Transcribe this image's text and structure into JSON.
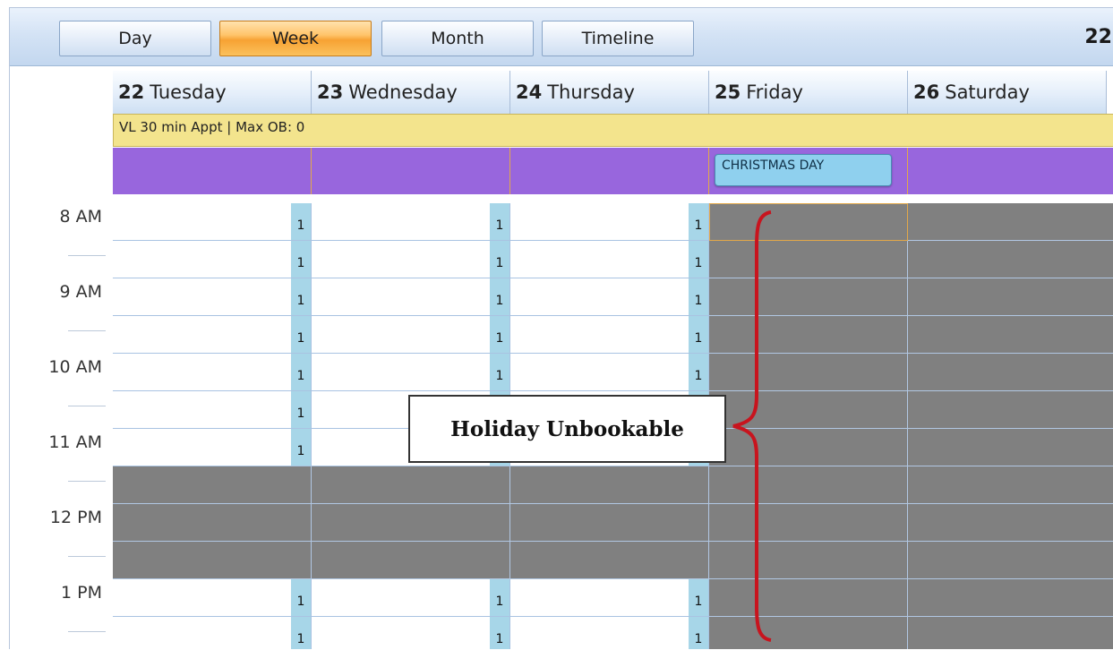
{
  "toolbar": {
    "views": [
      "Day",
      "Week",
      "Month",
      "Timeline"
    ],
    "active_view": "Week",
    "range_text": "22"
  },
  "days": [
    {
      "num": "22",
      "name": "Tuesday"
    },
    {
      "num": "23",
      "name": "Wednesday"
    },
    {
      "num": "24",
      "name": "Thursday"
    },
    {
      "num": "25",
      "name": "Friday"
    },
    {
      "num": "26",
      "name": "Saturday"
    }
  ],
  "all_day_banner": "VL 30 min Appt | Max OB: 0",
  "holiday_event": "CHRISTMAS DAY",
  "time_labels": [
    "8 AM",
    "9 AM",
    "10 AM",
    "11 AM",
    "12 PM",
    "1 PM"
  ],
  "slot_capacity": "1",
  "annotation": "Holiday Unbookable",
  "colors": {
    "active_tab": "#f7a233",
    "banner": "#f3e48d",
    "purple_band": "#9866dd",
    "unbookable": "#808080",
    "slot_marker": "#a7d6e8",
    "brace": "#c8141e"
  }
}
